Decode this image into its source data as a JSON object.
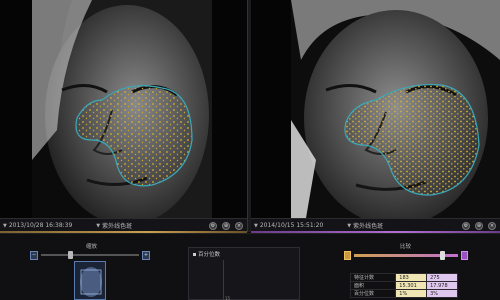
{
  "left_pane": {
    "datetime": "2013/10/28 16:38:39",
    "mode": "紫外线色斑"
  },
  "right_pane": {
    "datetime": "2014/10/15 15:51:20",
    "mode": "紫外线色斑"
  },
  "toolbar_icons": [
    "settings-icon",
    "zoom-icon",
    "close-icon"
  ],
  "zoom_section": {
    "title": "缩放",
    "minus": "−",
    "plus": "+",
    "level": 0.3
  },
  "chart_panel": {
    "title": "百分位数",
    "ytick": "15"
  },
  "compare_section": {
    "title": "比较",
    "position": 0.85
  },
  "stats": {
    "rows": [
      {
        "label": "特征计数",
        "v1": "183",
        "v2": "275"
      },
      {
        "label": "面积",
        "v1": "15.301",
        "v2": "17.978"
      },
      {
        "label": "百分位数",
        "v1": "1%",
        "v2": "3%"
      }
    ]
  },
  "colors": {
    "left_accent": "#c8a050",
    "right_accent": "#b070d0",
    "spot": "#d8b030",
    "outline": "#3aa8b8"
  }
}
